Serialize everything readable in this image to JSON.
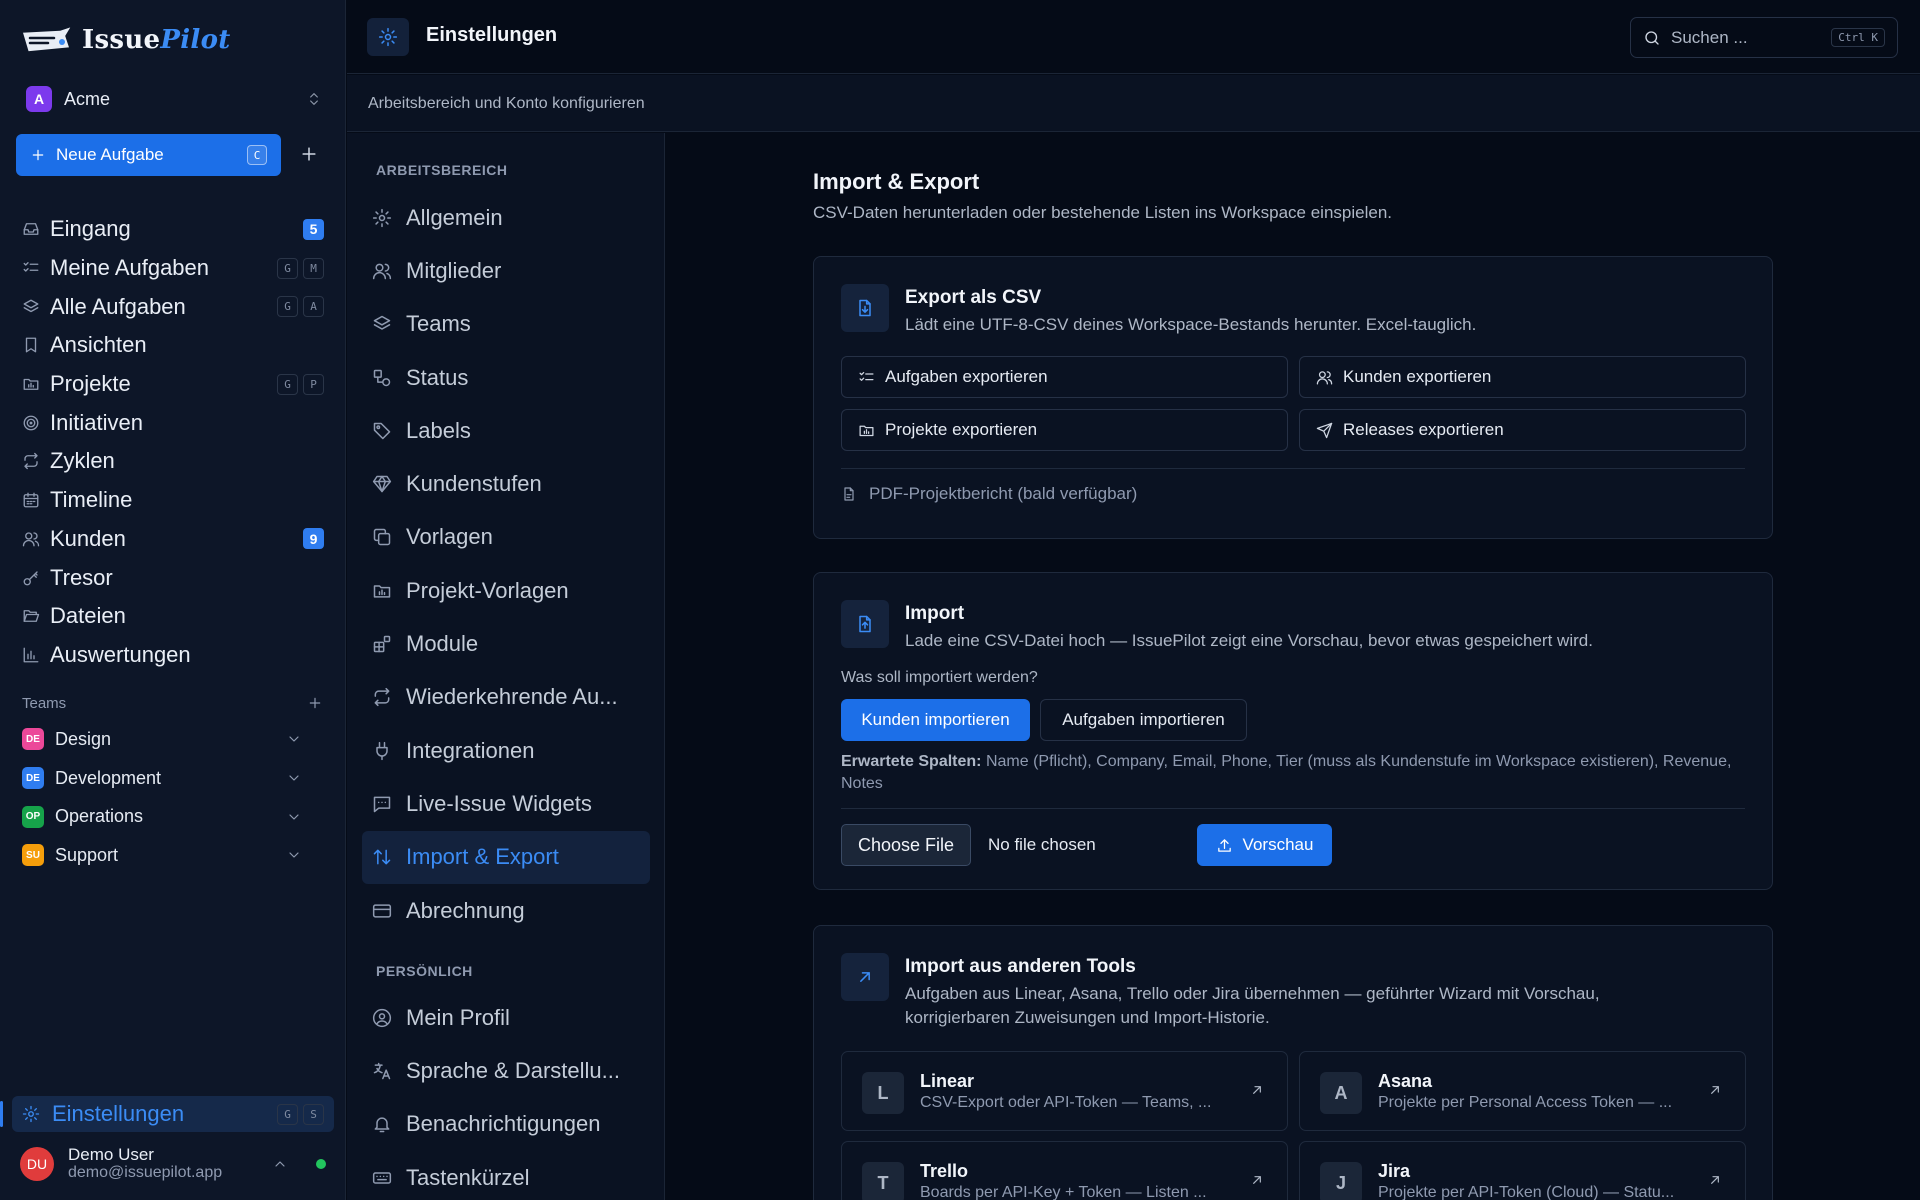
{
  "app": {
    "brand_a": "Issue",
    "brand_b": "Pilot"
  },
  "workspace": {
    "initial": "A",
    "name": "Acme",
    "color": "#7c3aed"
  },
  "new_task": {
    "label": "Neue Aufgabe",
    "shortcut": "C"
  },
  "nav": [
    {
      "label": "Eingang",
      "icon": "inbox-icon",
      "badge": "5"
    },
    {
      "label": "Meine Aufgaben",
      "icon": "list-check-icon",
      "keys": [
        "G",
        "M"
      ]
    },
    {
      "label": "Alle Aufgaben",
      "icon": "layers-icon",
      "keys": [
        "G",
        "A"
      ]
    },
    {
      "label": "Ansichten",
      "icon": "bookmark-icon"
    },
    {
      "label": "Projekte",
      "icon": "folder-chart-icon",
      "keys": [
        "G",
        "P"
      ]
    },
    {
      "label": "Initiativen",
      "icon": "target-icon"
    },
    {
      "label": "Zyklen",
      "icon": "repeat-icon"
    },
    {
      "label": "Timeline",
      "icon": "calendar-icon"
    },
    {
      "label": "Kunden",
      "icon": "users-icon",
      "badge": "9"
    },
    {
      "label": "Tresor",
      "icon": "key-icon"
    },
    {
      "label": "Dateien",
      "icon": "folder-open-icon"
    },
    {
      "label": "Auswertungen",
      "icon": "bar-chart-icon"
    }
  ],
  "teams": {
    "heading": "Teams",
    "items": [
      {
        "initials": "DE",
        "name": "Design",
        "color": "#ec4899"
      },
      {
        "initials": "DE",
        "name": "Development",
        "color": "#2f7df0"
      },
      {
        "initials": "OP",
        "name": "Operations",
        "color": "#16a34a"
      },
      {
        "initials": "SU",
        "name": "Support",
        "color": "#f59e0b"
      }
    ]
  },
  "settings_nav": {
    "label": "Einstellungen",
    "keys": [
      "G",
      "S"
    ]
  },
  "user": {
    "initials": "DU",
    "name": "Demo User",
    "email": "demo@issuepilot.app",
    "status_color": "#22c55e"
  },
  "header": {
    "title": "Einstellungen",
    "search_placeholder": "Suchen ...",
    "search_shortcut": "Ctrl K",
    "subtitle": "Arbeitsbereich und Konto konfigurieren"
  },
  "settings_menu": {
    "section1": "ARBEITSBEREICH",
    "items1": [
      {
        "label": "Allgemein",
        "icon": "gear-icon"
      },
      {
        "label": "Mitglieder",
        "icon": "users-icon"
      },
      {
        "label": "Teams",
        "icon": "layers-icon"
      },
      {
        "label": "Status",
        "icon": "shapes-icon"
      },
      {
        "label": "Labels",
        "icon": "tag-icon"
      },
      {
        "label": "Kundenstufen",
        "icon": "gem-icon"
      },
      {
        "label": "Vorlagen",
        "icon": "copy-icon"
      },
      {
        "label": "Projekt-Vorlagen",
        "icon": "folder-chart-icon"
      },
      {
        "label": "Module",
        "icon": "blocks-icon"
      },
      {
        "label": "Wiederkehrende Au...",
        "icon": "repeat-icon"
      },
      {
        "label": "Integrationen",
        "icon": "plug-icon"
      },
      {
        "label": "Live-Issue Widgets",
        "icon": "message-icon"
      },
      {
        "label": "Import & Export",
        "icon": "arrows-up-down-icon",
        "active": true
      },
      {
        "label": "Abrechnung",
        "icon": "credit-card-icon"
      }
    ],
    "section2": "PERSÖNLICH",
    "items2": [
      {
        "label": "Mein Profil",
        "icon": "user-circle-icon"
      },
      {
        "label": "Sprache & Darstellu...",
        "icon": "languages-icon"
      },
      {
        "label": "Benachrichtigungen",
        "icon": "bell-icon"
      },
      {
        "label": "Tastenkürzel",
        "icon": "keyboard-icon"
      }
    ]
  },
  "main": {
    "title": "Import & Export",
    "subtitle": "CSV-Daten herunterladen oder bestehende Listen ins Workspace einspielen.",
    "export": {
      "title": "Export als CSV",
      "desc": "Lädt eine UTF-8-CSV deines Workspace-Bestands herunter. Excel-tauglich.",
      "buttons": [
        "Aufgaben exportieren",
        "Kunden exportieren",
        "Projekte exportieren",
        "Releases exportieren"
      ],
      "pdf": "PDF-Projektbericht (bald verfügbar)"
    },
    "import": {
      "title": "Import",
      "desc": "Lade eine CSV-Datei hoch — IssuePilot zeigt eine Vorschau, bevor etwas gespeichert wird.",
      "question": "Was soll importiert werden?",
      "opt_active": "Kunden importieren",
      "opt_other": "Aufgaben importieren",
      "expected_label": "Erwartete Spalten:",
      "expected_cols": "Name (Pflicht), Company, Email, Phone, Tier (muss als Kundenstufe im Workspace existieren), Revenue, Notes",
      "file_button": "Choose File",
      "file_status": "No file chosen",
      "preview": "Vorschau"
    },
    "tools": {
      "title": "Import aus anderen Tools",
      "desc": "Aufgaben aus Linear, Asana, Trello oder Jira übernehmen — geführter Wizard mit Vorschau, korrigierbaren Zuweisungen und Import-Historie.",
      "items": [
        {
          "initial": "L",
          "name": "Linear",
          "desc": "CSV-Export oder API-Token — Teams, ..."
        },
        {
          "initial": "A",
          "name": "Asana",
          "desc": "Projekte per Personal Access Token — ..."
        },
        {
          "initial": "T",
          "name": "Trello",
          "desc": "Boards per API-Key + Token — Listen ..."
        },
        {
          "initial": "J",
          "name": "Jira",
          "desc": "Projekte per API-Token (Cloud) — Statu..."
        }
      ]
    }
  },
  "colors": {
    "accent": "#2f7df0",
    "background": "#050b17",
    "sidebar": "#0d1628"
  }
}
